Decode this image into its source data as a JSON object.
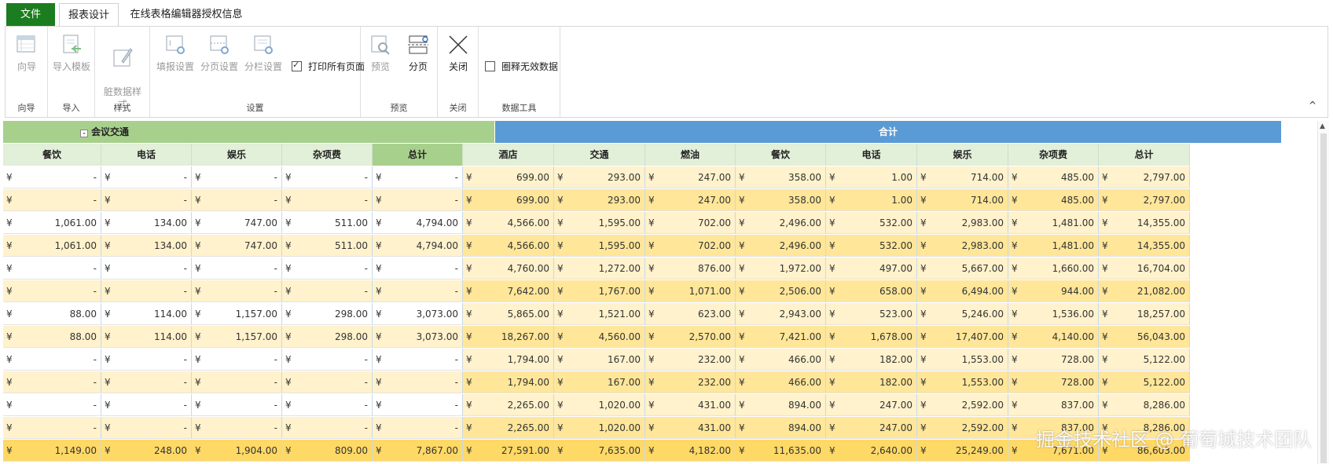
{
  "tabs": {
    "file": "文件",
    "report_design": "报表设计",
    "license_info": "在线表格编辑器授权信息"
  },
  "ribbon": {
    "wizard": "向导",
    "import_template": "导入模板",
    "dirty_style": "脏数据样\n式",
    "fill_settings": "填报设置",
    "page_settings": "分页设置",
    "column_settings": "分栏设置",
    "print_all_pages": "打印所有页面",
    "preview": "预览",
    "paging": "分页",
    "close": "关闭",
    "circle_invalid": "圈释无效数据",
    "groups": {
      "wizard": "向导",
      "import": "导入",
      "style": "样式",
      "settings": "设置",
      "preview": "预览",
      "close": "关闭",
      "data_tools": "数据工具"
    },
    "print_all_checked": true,
    "circle_invalid_checked": false
  },
  "sheet": {
    "band_left": "会议交通",
    "band_left_toggle": "-",
    "band_right": "合计",
    "currency": "¥",
    "headers": [
      "餐饮",
      "电话",
      "娱乐",
      "杂项费",
      "总计",
      "酒店",
      "交通",
      "燃油",
      "餐饮",
      "电话",
      "娱乐",
      "杂项费",
      "总计"
    ],
    "rows": [
      [
        "-",
        "-",
        "-",
        "-",
        "-",
        "699.00",
        "293.00",
        "247.00",
        "358.00",
        "1.00",
        "714.00",
        "485.00",
        "2,797.00"
      ],
      [
        "-",
        "-",
        "-",
        "-",
        "-",
        "699.00",
        "293.00",
        "247.00",
        "358.00",
        "1.00",
        "714.00",
        "485.00",
        "2,797.00"
      ],
      [
        "1,061.00",
        "134.00",
        "747.00",
        "511.00",
        "4,794.00",
        "4,566.00",
        "1,595.00",
        "702.00",
        "2,496.00",
        "532.00",
        "2,983.00",
        "1,481.00",
        "14,355.00"
      ],
      [
        "1,061.00",
        "134.00",
        "747.00",
        "511.00",
        "4,794.00",
        "4,566.00",
        "1,595.00",
        "702.00",
        "2,496.00",
        "532.00",
        "2,983.00",
        "1,481.00",
        "14,355.00"
      ],
      [
        "-",
        "-",
        "-",
        "-",
        "-",
        "4,760.00",
        "1,272.00",
        "876.00",
        "1,972.00",
        "497.00",
        "5,667.00",
        "1,660.00",
        "16,704.00"
      ],
      [
        "-",
        "-",
        "-",
        "-",
        "-",
        "7,642.00",
        "1,767.00",
        "1,071.00",
        "2,506.00",
        "658.00",
        "6,494.00",
        "944.00",
        "21,082.00"
      ],
      [
        "88.00",
        "114.00",
        "1,157.00",
        "298.00",
        "3,073.00",
        "5,865.00",
        "1,521.00",
        "623.00",
        "2,943.00",
        "523.00",
        "5,246.00",
        "1,536.00",
        "18,257.00"
      ],
      [
        "88.00",
        "114.00",
        "1,157.00",
        "298.00",
        "3,073.00",
        "18,267.00",
        "4,560.00",
        "2,570.00",
        "7,421.00",
        "1,678.00",
        "17,407.00",
        "4,140.00",
        "56,043.00"
      ],
      [
        "-",
        "-",
        "-",
        "-",
        "-",
        "1,794.00",
        "167.00",
        "232.00",
        "466.00",
        "182.00",
        "1,553.00",
        "728.00",
        "5,122.00"
      ],
      [
        "-",
        "-",
        "-",
        "-",
        "-",
        "1,794.00",
        "167.00",
        "232.00",
        "466.00",
        "182.00",
        "1,553.00",
        "728.00",
        "5,122.00"
      ],
      [
        "-",
        "-",
        "-",
        "-",
        "-",
        "2,265.00",
        "1,020.00",
        "431.00",
        "894.00",
        "247.00",
        "2,592.00",
        "837.00",
        "8,286.00"
      ],
      [
        "-",
        "-",
        "-",
        "-",
        "-",
        "2,265.00",
        "1,020.00",
        "431.00",
        "894.00",
        "247.00",
        "2,592.00",
        "837.00",
        "8,286.00"
      ],
      [
        "1,149.00",
        "248.00",
        "1,904.00",
        "809.00",
        "7,867.00",
        "27,591.00",
        "7,635.00",
        "4,182.00",
        "11,635.00",
        "2,640.00",
        "25,249.00",
        "7,671.00",
        "86,603.00"
      ]
    ]
  },
  "watermark": "掘金技术社区 @ 葡萄城技术团队"
}
